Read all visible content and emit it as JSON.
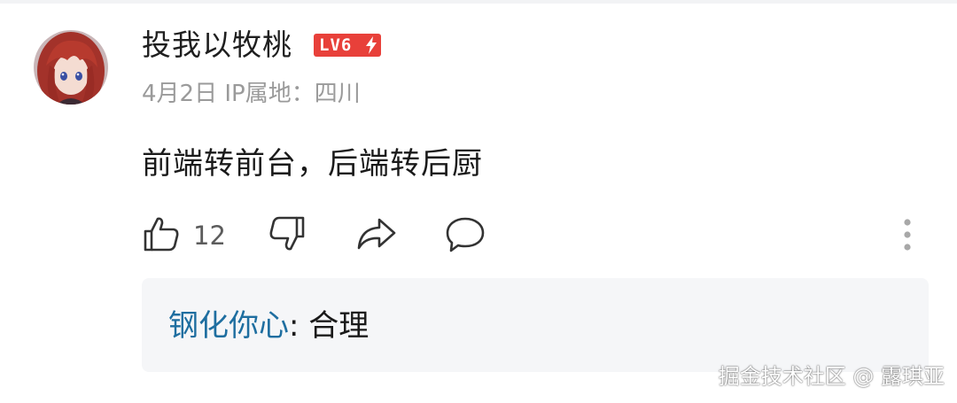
{
  "comment": {
    "username": "投我以牧桃",
    "level": "LV6",
    "date": "4月2日",
    "ip_location": "IP属地：四川",
    "text": "前端转前台，后端转后厨",
    "like_count": "12",
    "icons": {
      "like": "thumbs-up-icon",
      "dislike": "thumbs-down-icon",
      "share": "share-icon",
      "reply": "comment-icon",
      "more": "more-vertical-icon",
      "level_bolt": "lightning-icon"
    }
  },
  "reply": {
    "author": "钢化你心",
    "separator": ": ",
    "text": "合理"
  },
  "watermark": "掘金技术社区 @ 露琪亚",
  "colors": {
    "level_badge": "#e8403a",
    "reply_author": "#1e6ea0",
    "reply_background": "#f5f6f8",
    "meta_text": "#9a9a9a"
  }
}
